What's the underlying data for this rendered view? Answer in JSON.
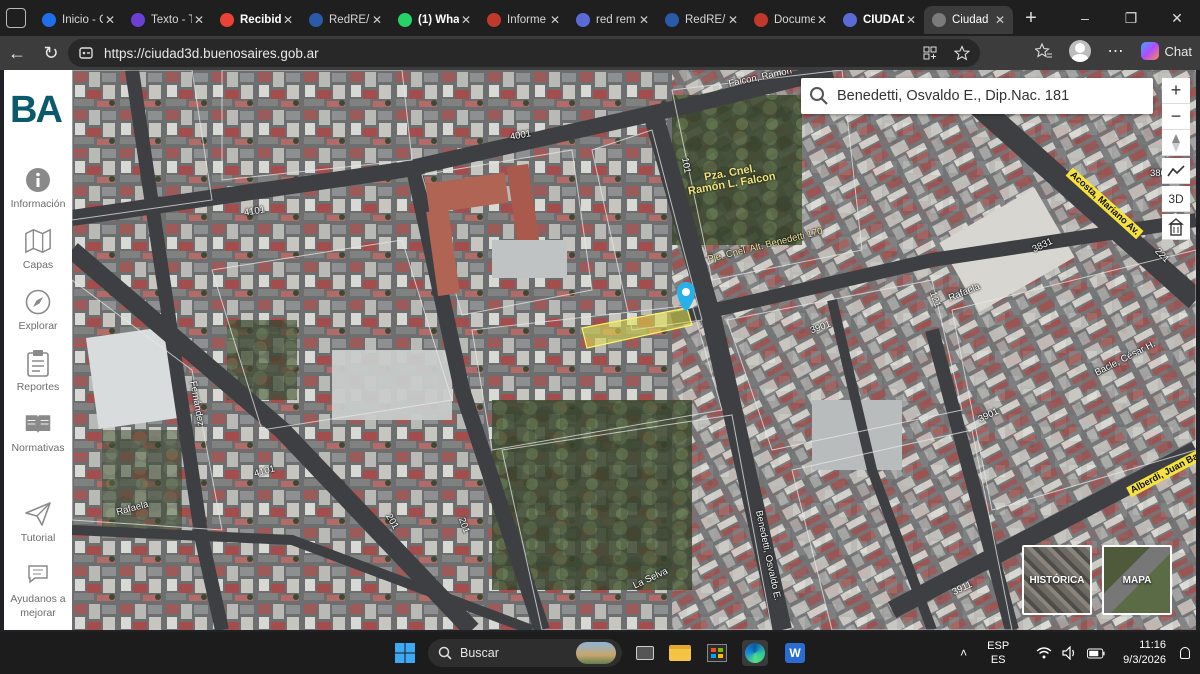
{
  "browser": {
    "tabs": [
      {
        "title": "Inicio - C",
        "favicon_color": "#1f6feb",
        "favicon": "edge-icon"
      },
      {
        "title": "Texto - T",
        "favicon_color": "#6b3fd3",
        "favicon": "video-icon"
      },
      {
        "title": "Recibido",
        "favicon_color": "#ea4335",
        "favicon": "gmail-icon"
      },
      {
        "title": "RedRE/M",
        "favicon_color": "#2b5aa8",
        "favicon": "redre-icon"
      },
      {
        "title": "(1) What",
        "favicon_color": "#25d366",
        "favicon": "whatsapp-icon"
      },
      {
        "title": "Informe",
        "favicon_color": "#c0392b",
        "favicon": "flag-icon"
      },
      {
        "title": "red rem",
        "favicon_color": "#5b6bd6",
        "favicon": "search-icon"
      },
      {
        "title": "RedRE/M",
        "favicon_color": "#2b5aa8",
        "favicon": "redre-icon"
      },
      {
        "title": "Docume",
        "favicon_color": "#c0392b",
        "favicon": "flag-icon"
      },
      {
        "title": "CIUDAD",
        "favicon_color": "#5b6bd6",
        "favicon": "search-icon"
      },
      {
        "title": "Ciudad",
        "favicon_color": "#7b7b7b",
        "favicon": "ba-icon"
      }
    ],
    "active_tab": 10,
    "url": "https://ciudad3d.buenosaires.gob.ar",
    "chat_label": "Chat"
  },
  "sidebar": {
    "logo": "BA",
    "items": [
      {
        "label": "Información",
        "icon": "info-icon"
      },
      {
        "label": "Capas",
        "icon": "map-layers-icon"
      },
      {
        "label": "Explorar",
        "icon": "compass-icon"
      },
      {
        "label": "Reportes",
        "icon": "clipboard-icon"
      },
      {
        "label": "Normativas",
        "icon": "book-icon"
      },
      {
        "label": "Tutorial",
        "icon": "paper-plane-icon"
      },
      {
        "label": "Ayudanos a mejorar",
        "icon": "feedback-icon"
      }
    ]
  },
  "search": {
    "value": "Benedetti, Osvaldo E., Dip.Nac. 181"
  },
  "map_controls": {
    "zoom_in": "+",
    "zoom_out": "−",
    "mode_3d": "3D"
  },
  "basemaps": {
    "historic": "HISTÓRICA",
    "map": "MAPA"
  },
  "map_labels": {
    "falcon_ramon": "Falcon, Ramón",
    "plaza": "Pza. Cnel. Ramón L. Falcon",
    "pje_benedetti": "Pje. Cnel. Alt. Benedetti 170",
    "acosta": "Acosta, Mariano Av.",
    "alberdi": "Alberdi, Juan Ba",
    "rafaela_top": "Rafaela",
    "rafaela_bottom": "Rafaela",
    "bacle": "Bacle, César H.",
    "benedetti": "Benedetti, Osvaldo E.",
    "la_selva": "La Selva",
    "fernandez": "Fernández",
    "num_4001": "4001",
    "num_4101a": "4101",
    "num_4101b": "4101",
    "num_3901a": "3901",
    "num_3901b": "3901",
    "num_3831": "3831",
    "num_3911": "3911",
    "num_3801": "3801",
    "num_101": "101",
    "num_201a": "201",
    "num_201b": "201",
    "num_121": "121",
    "num_221": "221"
  },
  "taskbar": {
    "search": "Buscar",
    "lang_top": "ESP",
    "lang_bottom": "ES",
    "time": "11:16",
    "date": "9/3/2026"
  }
}
